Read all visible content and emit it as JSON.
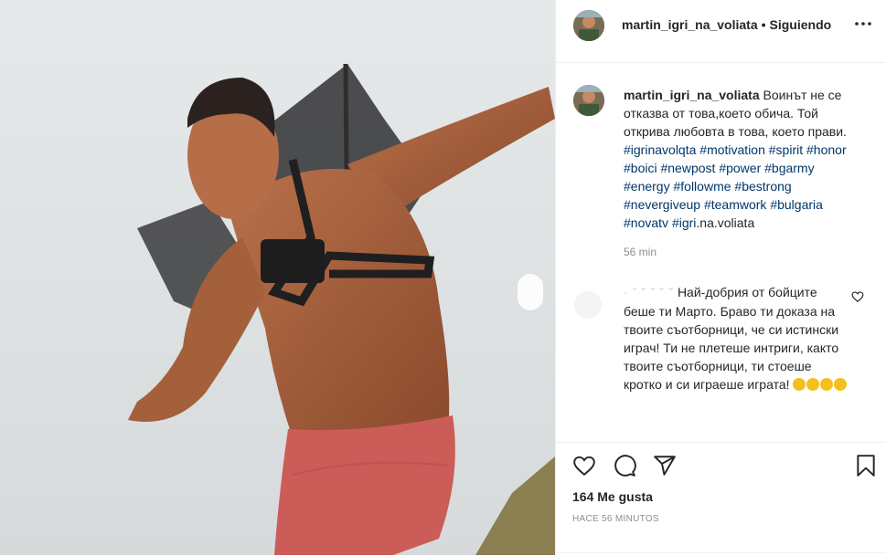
{
  "header": {
    "username": "martin_igri_na_voliata",
    "separator": "•",
    "follow_status": "Siguiendo",
    "more_icon": "more-horizontal-icon"
  },
  "caption": {
    "username": "martin_igri_na_voliata",
    "text": "Воинът не се отказва от това,което обича. Той открива любовта в това, което прави. ",
    "hashtags": [
      "#igrinavolqta",
      "#motivation",
      "#spirit",
      "#honor",
      "#boici",
      "#newpost",
      "#power",
      "#bgarmy",
      "#energy",
      "#followme",
      "#bestrong",
      "#nevergiveup",
      "#teamwork",
      "#bulgaria",
      "#novatv",
      "#igri"
    ],
    "trailing": ".na.voliata",
    "time": "56 min"
  },
  "comment": {
    "text": "Най-добрия от бойците беше ти Марто. Браво ти доказа на твоите съотборници, че си истински играч! Ти не плетеше интриги, както твоите съотборници, ти стоеше кротко и си играеше играта! ",
    "heart_icon": "heart-outline-icon"
  },
  "actions": {
    "like_icon": "heart-icon",
    "comment_icon": "comment-icon",
    "share_icon": "share-icon",
    "save_icon": "bookmark-icon"
  },
  "likes": "164 Me gusta",
  "post_time": "HACE 56 MINUTOS",
  "colors": {
    "hashtag": "#00376b",
    "text": "#262626",
    "muted": "#8e8e8e",
    "border": "#efefef"
  }
}
